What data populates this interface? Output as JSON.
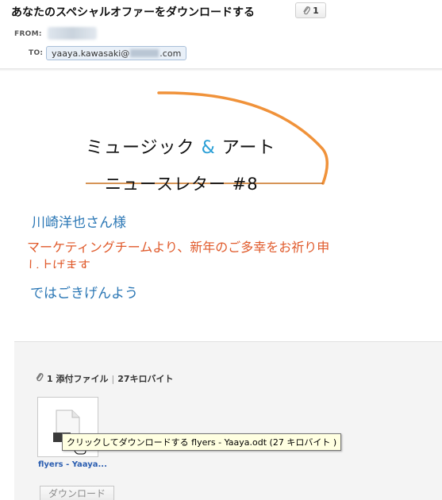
{
  "header": {
    "subject": "あなたのスペシャルオファーをダウンロードする",
    "attachment_count": "1",
    "from_label": "FROM:",
    "to_label": "TO:",
    "to_address_prefix": "yaaya.kawasaki@",
    "to_address_suffix": ".com"
  },
  "body": {
    "logo_line1_a": "ミュージック ",
    "logo_line1_amp": "&",
    "logo_line1_b": " アート",
    "logo_line2": "ニュースレター #8",
    "greeting": "川崎洋也さん様",
    "message": "マーケティングチームより、新年のご多幸をお祈り申し上げます",
    "closing": "ではごきげんよう"
  },
  "attachments": {
    "count_label": "1 添付ファイル",
    "separator": "|",
    "size_label": "27キロバイト",
    "tooltip": "クリックしてダウンロードする flyers - Yaaya.odt (27 キロバイト )",
    "file_link": "flyers - Yaaya...",
    "download_button": "ダウンロード"
  },
  "colors": {
    "accent_orange": "#f0923a",
    "accent_blue": "#2b77b5",
    "message_red": "#e05a2b"
  },
  "icons": {
    "paperclip": "paperclip-icon",
    "document": "document-icon",
    "hand_cursor": "hand-cursor-icon"
  }
}
